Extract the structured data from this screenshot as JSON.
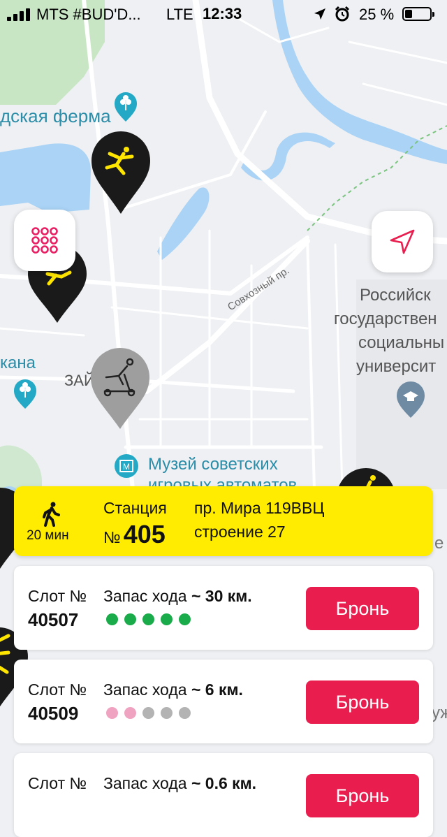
{
  "status_bar": {
    "carrier": "MTS #BUD'D...",
    "network": "LTE",
    "time": "12:33",
    "battery": "25 %"
  },
  "map": {
    "labels": {
      "ferma": "дская ферма",
      "prospect": "Совхозный пр.",
      "university_1": "Российск",
      "university_2": "государствен",
      "university_3": "социальны",
      "university_4": "университ",
      "kana": "кана",
      "zai": "ЗАЙ",
      "museum_1": "Музей советских",
      "museum_2": "игровых автоматов",
      "right_edge": "е",
      "right_edge_2": "уж"
    },
    "colors": {
      "water": "#aad3f5",
      "park": "#c8e6c4",
      "road": "#ffffff",
      "land": "#eef0f3",
      "pin": "#1a1a1a",
      "pin_icon": "#ffe600",
      "pin_inactive": "#9e9e9e",
      "poi": "#23a9c5"
    }
  },
  "buttons": {
    "grid_icon": "grid-icon",
    "locate_icon": "navigation-arrow-icon"
  },
  "station": {
    "walk_icon": "walking-person-icon",
    "walk_time": "20 мин",
    "label": "Станция",
    "number_prefix": "№",
    "number": "405",
    "address_line1": "пр. Мира 119ВВЦ",
    "address_line2": "строение 27"
  },
  "slots": [
    {
      "label": "Слот №",
      "number": "40507",
      "range_label": "Запас хода",
      "range_value": "~ 30 км.",
      "dots": [
        "#1aab4a",
        "#1aab4a",
        "#1aab4a",
        "#1aab4a",
        "#1aab4a"
      ],
      "button": "Бронь"
    },
    {
      "label": "Слот №",
      "number": "40509",
      "range_label": "Запас хода",
      "range_value": "~ 6 км.",
      "dots": [
        "#efa3c1",
        "#efa3c1",
        "#b3b3b3",
        "#b3b3b3",
        "#b3b3b3"
      ],
      "button": "Бронь"
    },
    {
      "label": "Слот №",
      "number": "",
      "range_label": "Запас хода",
      "range_value": "~ 0.6 км.",
      "dots": [],
      "button": "Бронь"
    }
  ]
}
